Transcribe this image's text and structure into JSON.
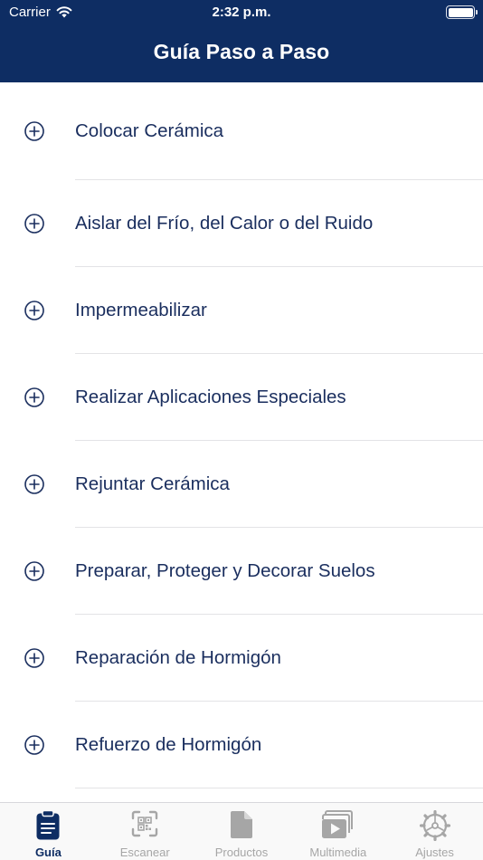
{
  "status_bar": {
    "carrier": "Carrier",
    "time": "2:32 p.m."
  },
  "header": {
    "title": "Guía Paso a Paso"
  },
  "list": {
    "items": [
      {
        "label": "Colocar Cerámica"
      },
      {
        "label": "Aislar del Frío, del Calor o del Ruido"
      },
      {
        "label": "Impermeabilizar"
      },
      {
        "label": "Realizar Aplicaciones Especiales"
      },
      {
        "label": "Rejuntar Cerámica"
      },
      {
        "label": "Preparar, Proteger y Decorar Suelos"
      },
      {
        "label": "Reparación de Hormigón"
      },
      {
        "label": "Refuerzo de Hormigón"
      }
    ]
  },
  "tab_bar": {
    "tabs": [
      {
        "label": "Guía",
        "icon": "clipboard-icon",
        "active": true
      },
      {
        "label": "Escanear",
        "icon": "qr-scan-icon",
        "active": false
      },
      {
        "label": "Productos",
        "icon": "document-icon",
        "active": false
      },
      {
        "label": "Multimedia",
        "icon": "video-library-icon",
        "active": false
      },
      {
        "label": "Ajustes",
        "icon": "gear-icon",
        "active": false
      }
    ]
  },
  "colors": {
    "brand_navy": "#0e2d63",
    "item_text": "#1a2e5e",
    "tab_inactive": "#a6a6a6"
  }
}
